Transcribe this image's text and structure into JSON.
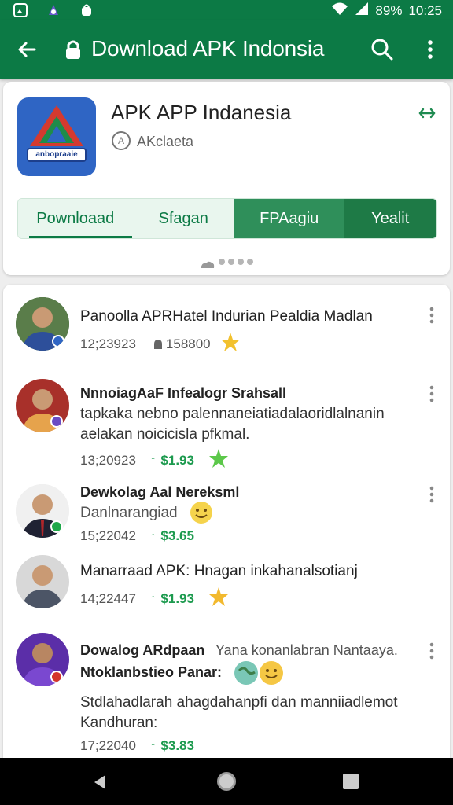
{
  "status_bar": {
    "battery": "89%",
    "time": "10:25"
  },
  "app_bar": {
    "title": "Download APK Indonsia"
  },
  "app": {
    "name": "APK APP Indanesia",
    "developer": "AKclaeta",
    "logo_text": "anbopraaie"
  },
  "tabs": [
    "Pownloaad",
    "Sfagan",
    "FPAagiu",
    "Yealit"
  ],
  "feed": [
    {
      "headline": "Panoolla APRHatel Indurian Pealdia Madlan",
      "date": "12;23923",
      "count": "158800"
    },
    {
      "headline": "NnnoiagAaF Infealogr Srahsall",
      "body_line1": "tapkaka nebno palennaneiatiadalaoridlalnanin",
      "body_line2": "aelakan noicicisla pfkmal.",
      "date": "13;20923",
      "price": "$1.93"
    },
    {
      "headline": "Dewkolag Aal Nereksml",
      "sub": "Danlnarangiad",
      "date": "15;22042",
      "price": "$3.65"
    },
    {
      "headline": "Manarraad APK: Hnagan inkahanalsotianj",
      "date": "14;22447",
      "price": "$1.93"
    },
    {
      "headline": "Dowalog ARdpaan",
      "headline_extra": "Yana konanlabran Nantaaya.",
      "sub": "Ntoklanbstieo Panar:",
      "body_line1": "Stdlahadlarah ahagdahanpfi dan manniiadlemot",
      "body_line2": "Kandhuran:",
      "date": "17;22040",
      "price": "$3.83"
    }
  ]
}
